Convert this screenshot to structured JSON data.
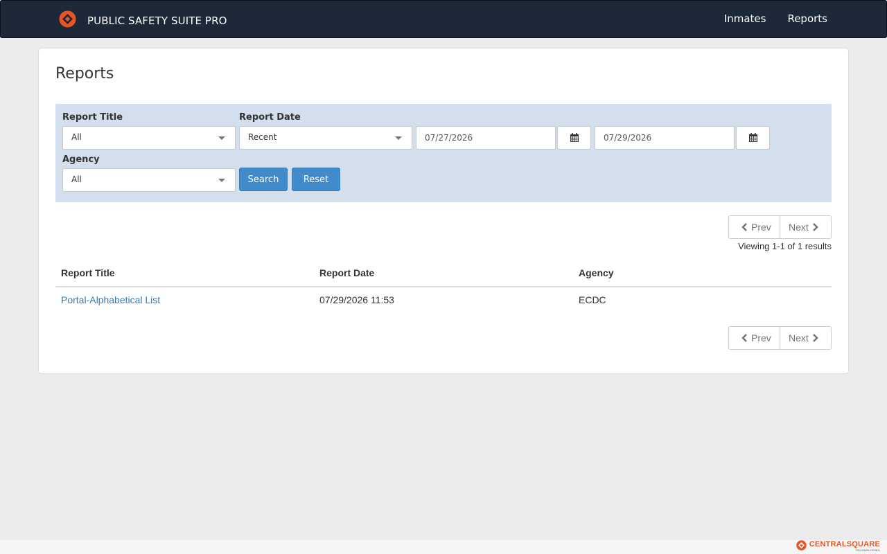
{
  "header": {
    "brand": "PUBLIC SAFETY SUITE PRO",
    "nav": [
      {
        "label": "Inmates"
      },
      {
        "label": "Reports"
      }
    ]
  },
  "page": {
    "title": "Reports"
  },
  "filters": {
    "report_title_label": "Report Title",
    "report_title_value": "All",
    "report_date_label": "Report Date",
    "report_date_value": "Recent",
    "date_from": "07/27/2026",
    "date_to": "07/29/2026",
    "agency_label": "Agency",
    "agency_value": "All",
    "search_label": "Search",
    "reset_label": "Reset"
  },
  "pagination": {
    "prev_label": "Prev",
    "next_label": "Next",
    "viewing_text": "Viewing 1-1 of 1 results"
  },
  "table": {
    "columns": [
      "Report Title",
      "Report Date",
      "Agency"
    ],
    "rows": [
      {
        "title": "Portal-Alphabetical List",
        "date": "07/29/2026 11:53",
        "agency": "ECDC"
      }
    ]
  },
  "footer": {
    "brand": "CENTRALSQUARE",
    "brand_sub": "TECHNOLOGIES"
  },
  "colors": {
    "navbar": "#1d2939",
    "brand_orange": "#e4562a",
    "filter_bg": "#d3dfec",
    "primary": "#428bca",
    "link": "#337ab7"
  }
}
